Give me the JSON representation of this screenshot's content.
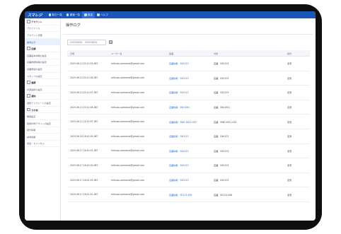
{
  "nav": {
    "logo": "スマレジ",
    "items": [
      {
        "label": "取引一覧",
        "active": false
      },
      {
        "label": "顧客一覧",
        "active": false
      },
      {
        "label": "設定",
        "active": true
      },
      {
        "label": "ヘルプ",
        "active": false
      }
    ]
  },
  "sidebar": {
    "items": [
      {
        "label": "アカウント",
        "type": "group"
      },
      {
        "label": "プロファイル",
        "type": "item"
      },
      {
        "label": "アカウント管理",
        "type": "item"
      },
      {
        "label": "操作ログ",
        "type": "active"
      },
      {
        "label": "店舗",
        "type": "group"
      },
      {
        "label": "店舗基本情報の設定",
        "type": "item"
      },
      {
        "label": "店舗詳細情報の設定",
        "type": "item"
      },
      {
        "label": "営業時間の設定",
        "type": "item"
      },
      {
        "label": "スタッフの設定",
        "type": "item"
      },
      {
        "label": "連携",
        "type": "group"
      },
      {
        "label": "外部連携の設定",
        "type": "item"
      },
      {
        "label": "通知",
        "type": "group"
      },
      {
        "label": "通知テンプレートの設定",
        "type": "item"
      },
      {
        "label": "その他",
        "type": "group"
      },
      {
        "label": "機能設定",
        "type": "item"
      },
      {
        "label": "簡易印刷デザインの設定",
        "type": "item"
      },
      {
        "label": "受付情報",
        "type": "item"
      },
      {
        "label": "請求情報",
        "type": "item"
      },
      {
        "label": "退会・キャンセル",
        "type": "item"
      }
    ]
  },
  "page": {
    "title": "操作ログ",
    "date_range": "2020/06/01 - 2020/06/31"
  },
  "table": {
    "headers": [
      "日時",
      "ユーザー名",
      "画面",
      "対象",
      "操作"
    ],
    "rows": [
      [
        "2020.06.13 20:12:09.387",
        "mitsuou.someone@gmail.com",
        "店舗情報・SX0123",
        "店舗：SX0123",
        "変更"
      ],
      [
        "2020.06.13 20:12:08.387",
        "mitsuou.someone@gmail.com",
        "店舗情報・SX0123",
        "店舗：SX0123",
        "変更"
      ],
      [
        "2020.06.13 20:12:07.387",
        "mitsuou.someone@gmail.com",
        "店舗情報・SX0123",
        "店舗：SX0123",
        "変更"
      ],
      [
        "2020.06.13 20:12:06.387",
        "mitsuou.someone@gmail.com",
        "店舗情報・SW-0001",
        "店舗：SW-0001",
        "変更"
      ],
      [
        "2020.06.12 14:22:07.387",
        "mitsuou.someone@gmail.com",
        "店舗情報・SWE-0001-000",
        "店舗：SWE-0001-000",
        "変更"
      ],
      [
        "2020.06.18 16:42:05.387",
        "mitsuou.someone@gmail.com",
        "店舗情報・SX0123",
        "店舗：SX0123",
        "変更"
      ],
      [
        "2020.06.17 16:42:01.387",
        "mitsuou.someone@gmail.com",
        "店舗情報・SX0123",
        "店舗：SX0123",
        "変更"
      ],
      [
        "2020.06.17 16:42:00.387",
        "mitsuou.someone@gmail.com",
        "店舗情報・SX0123",
        "店舗：SX0123",
        "変更"
      ],
      [
        "2020.06.17 16:41:55.387",
        "mitsuou.someone@gmail.com",
        "店舗情報・SX0123",
        "店舗：SX0123",
        "変更"
      ],
      [
        "2020.06.17 16:41:52.387",
        "mitsuou.someone@gmail.com",
        "店舗情報・SE123-456",
        "店舗：SE123-456",
        "変更"
      ]
    ]
  },
  "colors": {
    "accent": "#1a56b8",
    "link": "#2f6fd6",
    "bezel": "#0f0f12"
  }
}
